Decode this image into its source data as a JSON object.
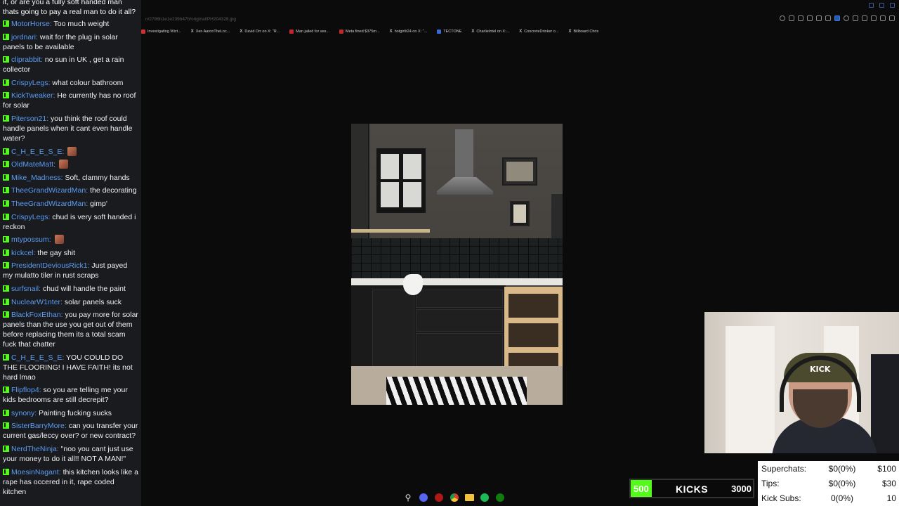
{
  "chat": {
    "top_text": "it, or are you a fully soft handed man thats going to pay a real man to do it all?",
    "messages": [
      {
        "user": "MotorHorse",
        "text": "Too much weight"
      },
      {
        "user": "jordnari",
        "text": "wait for the plug in solar panels to be available"
      },
      {
        "user": "cliprabbit",
        "text": "no sun in UK , get a rain collector"
      },
      {
        "user": "CrispyLegs",
        "text": "what colour bathroom"
      },
      {
        "user": "KickTweaker",
        "text": "He currently has no roof for solar"
      },
      {
        "user": "Piterson21",
        "text": "you think the roof could handle panels when it cant even handle water?"
      },
      {
        "user": "C_H_E_E_S_E",
        "text": "",
        "emote": true
      },
      {
        "user": "OldMateMatt",
        "text": "",
        "emote": true
      },
      {
        "user": "Mike_Madness",
        "text": "Soft, clammy hands"
      },
      {
        "user": "TheeGrandWizardMan",
        "text": "the decorating"
      },
      {
        "user": "TheeGrandWizardMan",
        "text": "gimp'"
      },
      {
        "user": "CrispyLegs",
        "text": "chud is very soft handed i reckon"
      },
      {
        "user": "mtypossum",
        "text": "",
        "emote": true
      },
      {
        "user": "kickcel",
        "text": "the gay shit"
      },
      {
        "user": "PresidentDeviousRick1",
        "text": "Just payed my mulatto tiler in rust scraps"
      },
      {
        "user": "surfsnail",
        "text": "chud will handle the paint"
      },
      {
        "user": "NuclearW1nter",
        "text": "solar panels suck"
      },
      {
        "user": "BlackFoxEthan",
        "text": "you pay more for solar panels than the use you get out of them before replacing them its a total scam fuck that chatter"
      },
      {
        "user": "C_H_E_E_S_E",
        "text": "YOU COULD DO THE FLOORING! I HAVE FAITH! its not hard lmao"
      },
      {
        "user": "Flipflop4",
        "text": "so you are telling me your kids bedrooms are still decrepit?"
      },
      {
        "user": "synony",
        "text": "Painting fucking sucks"
      },
      {
        "user": "SisterBarryMore",
        "text": "can you transfer your current gas/leccy over? or new contract?"
      },
      {
        "user": "NerdTheNinja",
        "text": "\"noo you cant just use your money to do it all!! NOT A MAN!\""
      },
      {
        "user": "MoesinNagant",
        "text": "this kitchen looks like a rape has occered in it, rape coded kitchen"
      }
    ]
  },
  "browser": {
    "url": "n/2786b1e1e239b47b/original/PH204328.jpg",
    "bookmarks": [
      {
        "label": "Investigating Wizt...",
        "icon": "bookmark-icon",
        "color": "#d03030"
      },
      {
        "label": "Xen AaronTheLoc...",
        "icon": "x-icon",
        "color": "#ffffff"
      },
      {
        "label": "David Orr on X: \"R...",
        "icon": "x-icon",
        "color": "#ffffff"
      },
      {
        "label": "Man jailed for ass...",
        "icon": "bookmark-icon",
        "color": "#c0282d"
      },
      {
        "label": "Meta fined $375m...",
        "icon": "bookmark-icon",
        "color": "#c0282d"
      },
      {
        "label": "hotgirl#24 on X: \"...",
        "icon": "x-icon",
        "color": "#ffffff"
      },
      {
        "label": "TECTONE",
        "icon": "bookmark-icon",
        "color": "#3a6ad8"
      },
      {
        "label": "CharlieIntel on X:...",
        "icon": "x-icon",
        "color": "#ffffff"
      },
      {
        "label": "ConcreteDrinker o...",
        "icon": "x-icon",
        "color": "#ffffff"
      },
      {
        "label": "Billboard Chris",
        "icon": "x-icon",
        "color": "#ffffff"
      }
    ]
  },
  "webcam": {
    "cap_text": "KICK"
  },
  "kicks_goal": {
    "title": "KICKS",
    "start": "500",
    "end": "3000",
    "progress": 0.17,
    "fill_color": "#53fc18"
  },
  "stats": [
    {
      "label": "Superchats:",
      "value": "$0(0%)",
      "goal": "$100"
    },
    {
      "label": "Tips:",
      "value": "$0(0%)",
      "goal": "$30"
    },
    {
      "label": "Kick Subs:",
      "value": "0(0%)",
      "goal": "10"
    }
  ],
  "taskbar": [
    {
      "name": "windows-start-icon"
    },
    {
      "name": "search-icon"
    },
    {
      "name": "discord-icon"
    },
    {
      "name": "red-app-icon"
    },
    {
      "name": "chrome-icon"
    },
    {
      "name": "file-explorer-icon"
    },
    {
      "name": "spotify-icon"
    },
    {
      "name": "xbox-icon"
    }
  ],
  "colors": {
    "accent": "#53fc18",
    "username": "#5b9bf2",
    "chat_bg": "#191b1f"
  }
}
